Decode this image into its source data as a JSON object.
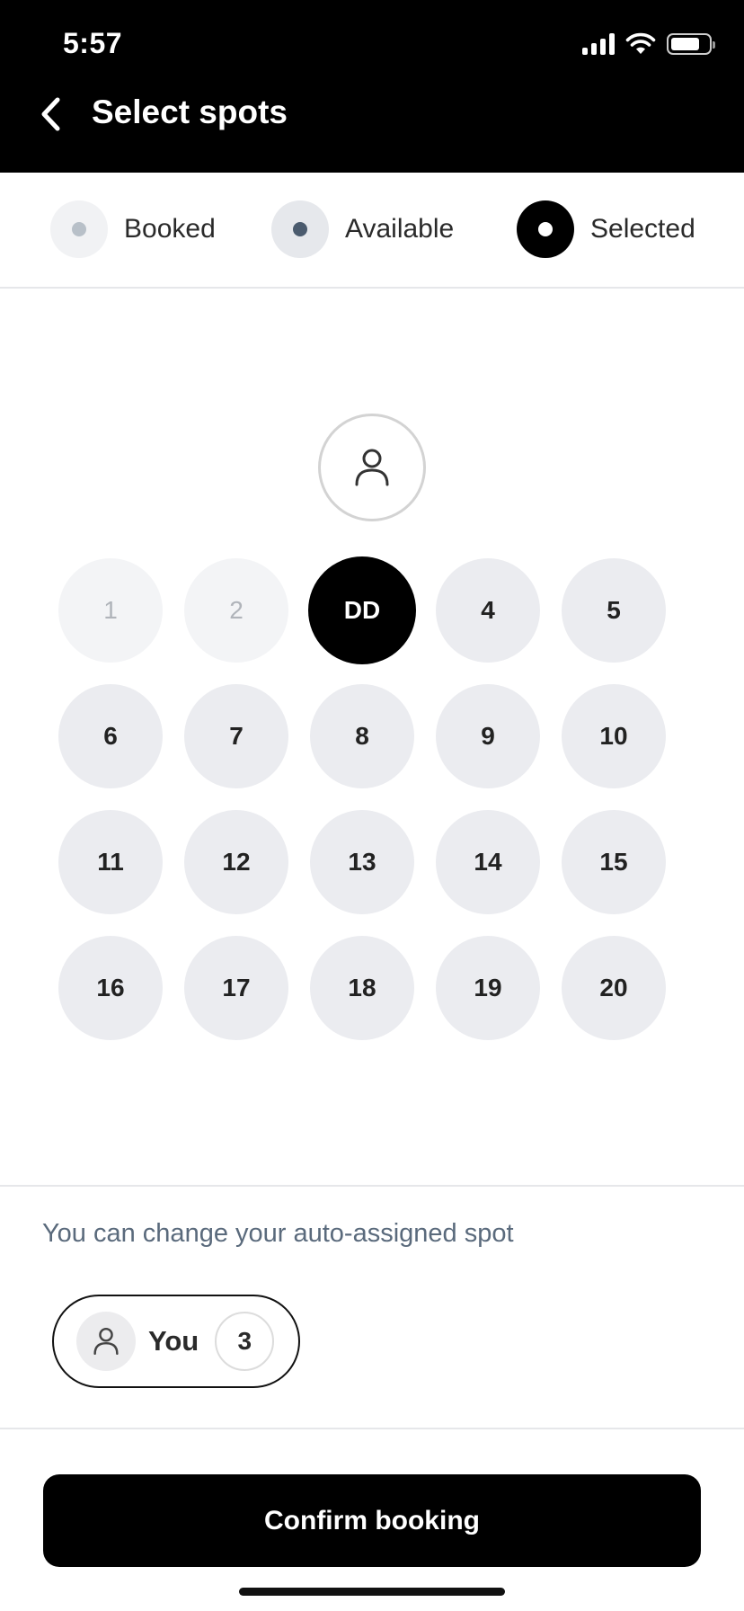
{
  "status_bar": {
    "time": "5:57"
  },
  "header": {
    "title": "Select spots"
  },
  "legend": [
    {
      "label": "Booked",
      "bg": "#f1f2f4",
      "dot": "#b8c0c8"
    },
    {
      "label": "Available",
      "bg": "#e6e8ec",
      "dot": "#4b5b6e"
    },
    {
      "label": "Selected",
      "bg": "#000000",
      "dot": "#ffffff"
    }
  ],
  "spots": [
    {
      "label": "1",
      "state": "booked"
    },
    {
      "label": "2",
      "state": "booked"
    },
    {
      "label": "DD",
      "state": "selected"
    },
    {
      "label": "4",
      "state": "available"
    },
    {
      "label": "5",
      "state": "available"
    },
    {
      "label": "6",
      "state": "available"
    },
    {
      "label": "7",
      "state": "available"
    },
    {
      "label": "8",
      "state": "available"
    },
    {
      "label": "9",
      "state": "available"
    },
    {
      "label": "10",
      "state": "available"
    },
    {
      "label": "11",
      "state": "available"
    },
    {
      "label": "12",
      "state": "available"
    },
    {
      "label": "13",
      "state": "available"
    },
    {
      "label": "14",
      "state": "available"
    },
    {
      "label": "15",
      "state": "available"
    },
    {
      "label": "16",
      "state": "available"
    },
    {
      "label": "17",
      "state": "available"
    },
    {
      "label": "18",
      "state": "available"
    },
    {
      "label": "19",
      "state": "available"
    },
    {
      "label": "20",
      "state": "available"
    }
  ],
  "assignment": {
    "hint": "You can change your auto-assigned spot",
    "you_label": "You",
    "spot_number": "3"
  },
  "confirm_button": {
    "label": "Confirm booking"
  }
}
